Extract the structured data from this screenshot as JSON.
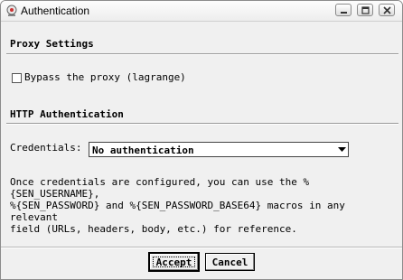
{
  "window": {
    "title": "Authentication"
  },
  "proxy": {
    "section_title": "Proxy Settings",
    "bypass_label": "Bypass the proxy (lagrange)",
    "bypass_checked": false
  },
  "http_auth": {
    "section_title": "HTTP Authentication",
    "credentials_label": "Credentials:",
    "credentials_selected": "No authentication"
  },
  "help_text": "Once credentials are configured, you can use the %{SEN_USERNAME},\n%{SEN_PASSWORD} and %{SEN_PASSWORD_BASE64} macros in any relevant\nfield (URLs, headers, body, etc.) for reference.",
  "buttons": {
    "accept": "Accept",
    "cancel": "Cancel"
  },
  "icons": {
    "app": "app-icon",
    "minimize": "minimize-icon",
    "maximize": "maximize-icon",
    "close": "close-icon",
    "dropdown": "chevron-down-icon"
  }
}
